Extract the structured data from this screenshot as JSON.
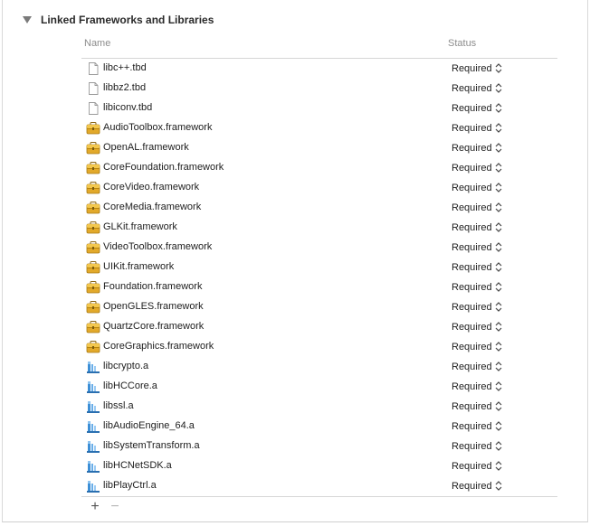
{
  "section": {
    "title": "Linked Frameworks and Libraries"
  },
  "columns": {
    "name": "Name",
    "status": "Status"
  },
  "rows": [
    {
      "name": "libc++.tbd",
      "status": "Required",
      "icon": "document-icon"
    },
    {
      "name": "libbz2.tbd",
      "status": "Required",
      "icon": "document-icon"
    },
    {
      "name": "libiconv.tbd",
      "status": "Required",
      "icon": "document-icon"
    },
    {
      "name": "AudioToolbox.framework",
      "status": "Required",
      "icon": "framework-icon"
    },
    {
      "name": "OpenAL.framework",
      "status": "Required",
      "icon": "framework-icon"
    },
    {
      "name": "CoreFoundation.framework",
      "status": "Required",
      "icon": "framework-icon"
    },
    {
      "name": "CoreVideo.framework",
      "status": "Required",
      "icon": "framework-icon"
    },
    {
      "name": "CoreMedia.framework",
      "status": "Required",
      "icon": "framework-icon"
    },
    {
      "name": "GLKit.framework",
      "status": "Required",
      "icon": "framework-icon"
    },
    {
      "name": "VideoToolbox.framework",
      "status": "Required",
      "icon": "framework-icon"
    },
    {
      "name": "UIKit.framework",
      "status": "Required",
      "icon": "framework-icon"
    },
    {
      "name": "Foundation.framework",
      "status": "Required",
      "icon": "framework-icon"
    },
    {
      "name": "OpenGLES.framework",
      "status": "Required",
      "icon": "framework-icon"
    },
    {
      "name": "QuartzCore.framework",
      "status": "Required",
      "icon": "framework-icon"
    },
    {
      "name": "CoreGraphics.framework",
      "status": "Required",
      "icon": "framework-icon"
    },
    {
      "name": "libcrypto.a",
      "status": "Required",
      "icon": "static-library-icon"
    },
    {
      "name": "libHCCore.a",
      "status": "Required",
      "icon": "static-library-icon"
    },
    {
      "name": "libssl.a",
      "status": "Required",
      "icon": "static-library-icon"
    },
    {
      "name": "libAudioEngine_64.a",
      "status": "Required",
      "icon": "static-library-icon"
    },
    {
      "name": "libSystemTransform.a",
      "status": "Required",
      "icon": "static-library-icon"
    },
    {
      "name": "libHCNetSDK.a",
      "status": "Required",
      "icon": "static-library-icon"
    },
    {
      "name": "libPlayCtrl.a",
      "status": "Required",
      "icon": "static-library-icon"
    }
  ],
  "toolbar": {
    "add_label": "+",
    "remove_label": "−"
  },
  "colors": {
    "framework_body": "#e2a92a",
    "framework_top": "#f3c74d",
    "library_blue": "#3d8fd6",
    "divider": "#d6d6d6"
  }
}
